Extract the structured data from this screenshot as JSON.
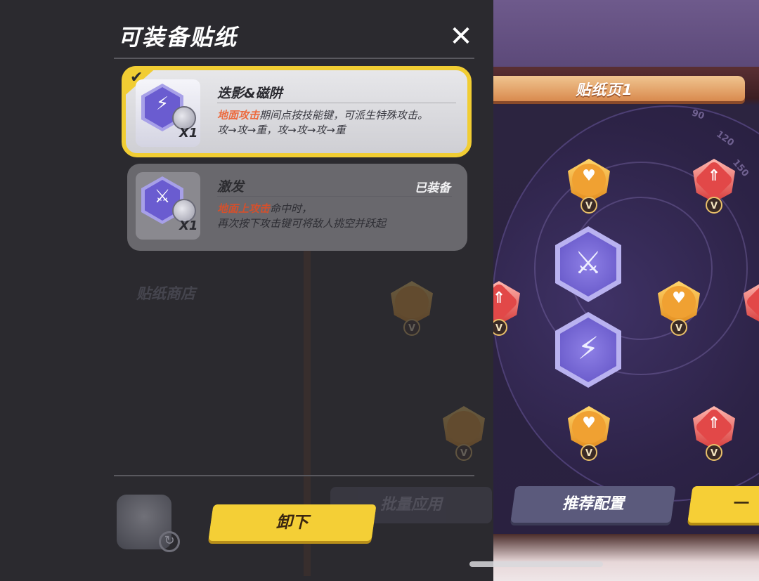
{
  "panel": {
    "title": "可装备贴纸",
    "close_icon": "✕",
    "cards": [
      {
        "name": "迭影&磁阱",
        "quantity": "X1",
        "selected": true,
        "desc_highlight": "地面攻击",
        "desc_rest": "期间点按技能键，可派生特殊攻击。",
        "desc_line2": "攻→攻→重，攻→攻→攻→重"
      },
      {
        "name": "激发",
        "quantity": "X1",
        "status": "已装备",
        "desc_highlight": "地面上攻击",
        "desc_rest": "命中时，",
        "desc_line2": "再次按下攻击键可将敌人挑空并跃起"
      }
    ],
    "unequip_label": "卸下"
  },
  "background": {
    "shop_label": "贴纸商店",
    "batch_label": "批量应用"
  },
  "board": {
    "title": "贴纸页1",
    "recommend_label": "推荐配置",
    "onekey_label": "一",
    "badge_letter": "V",
    "dial_ticks": [
      "90",
      "120",
      "150"
    ]
  },
  "colors": {
    "accent_yellow": "#f4cf36",
    "highlight_orange": "#ec6a3e",
    "gem_purple": "#6a5cd0"
  }
}
